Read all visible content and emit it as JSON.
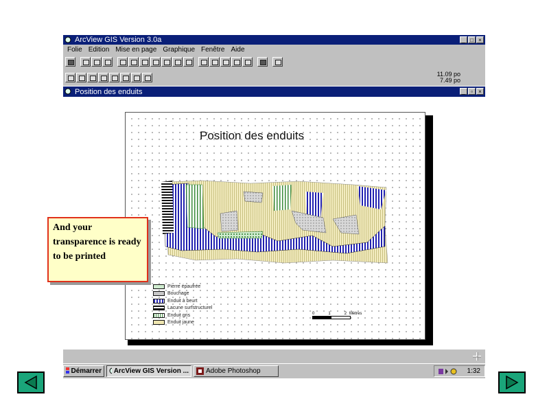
{
  "app": {
    "title": "ArcView GIS Version 3.0a",
    "menu": [
      "Folie",
      "Edition",
      "Mise en page",
      "Graphique",
      "Fenêtre",
      "Aide"
    ],
    "coords": {
      "x": "11.09 po",
      "y": "7.49 po"
    }
  },
  "subwindow": {
    "title": "Position des enduits"
  },
  "layout": {
    "map_title": "Position des enduits",
    "legend": [
      {
        "label": "Pierre épaufrée",
        "color": "#8fd18f"
      },
      {
        "label": "Bouchage",
        "color": "#b8b8b8"
      },
      {
        "label": "Enduit à beurt",
        "color": "#2a2ab8"
      },
      {
        "label": "Lacune surfstructurel",
        "color": "#111111"
      },
      {
        "label": "Enduit gris",
        "color": "#5aa05a"
      },
      {
        "label": "Enduit jaune",
        "color": "#efe6b0"
      }
    ],
    "scale_bar": {
      "ticks": [
        "0",
        "1",
        "2"
      ],
      "unit": "Mètres"
    }
  },
  "callout": {
    "text": "And your transparence is ready to be printed"
  },
  "taskbar": {
    "start": "Démarrer",
    "items": [
      "ArcView GIS Version ...",
      "Adobe Photoshop"
    ],
    "clock": "1:32"
  },
  "nav": {
    "prev": "previous",
    "next": "next"
  }
}
